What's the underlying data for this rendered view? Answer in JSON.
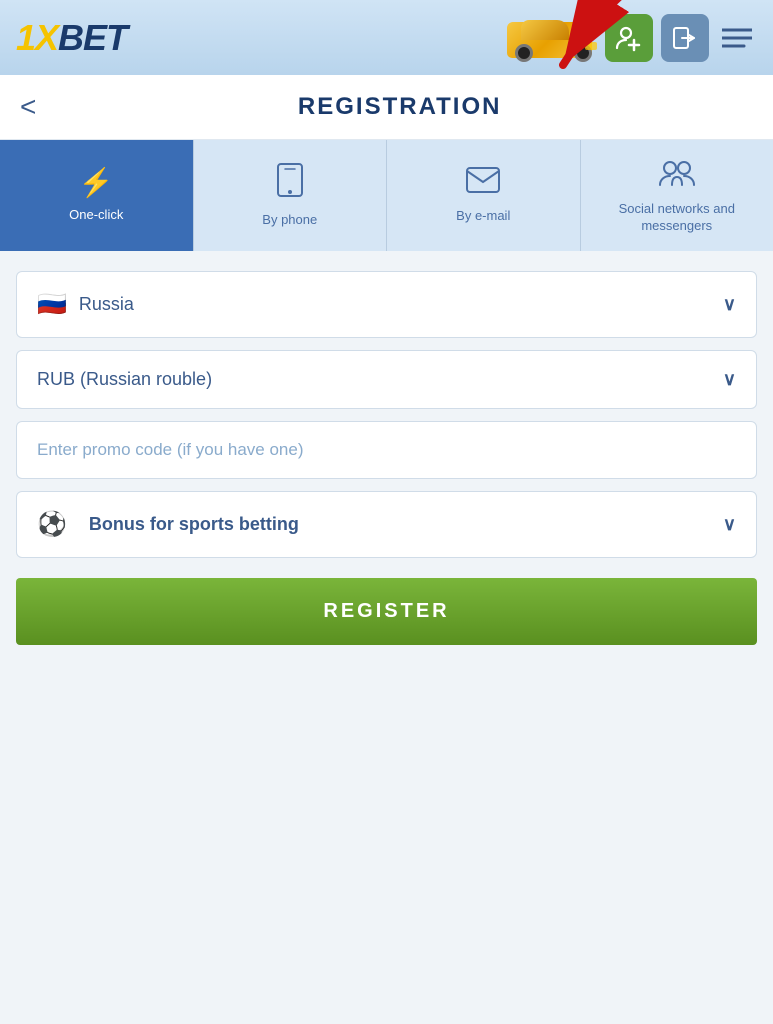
{
  "header": {
    "logo_text": "1XBET",
    "buttons": {
      "profile_label": "profile-icon",
      "login_label": "login-icon",
      "menu_label": "menu-icon"
    }
  },
  "page": {
    "back_label": "<",
    "title": "REGISTRATION"
  },
  "tabs": [
    {
      "id": "one-click",
      "icon": "⚡",
      "label": "One-click",
      "active": true
    },
    {
      "id": "by-phone",
      "icon": "📱",
      "label": "By phone",
      "active": false
    },
    {
      "id": "by-email",
      "icon": "✉",
      "label": "By e-mail",
      "active": false
    },
    {
      "id": "social",
      "icon": "👥",
      "label": "Social networks and messengers",
      "active": false
    }
  ],
  "form": {
    "country_label": "Russia",
    "currency_label": "RUB (Russian rouble)",
    "promo_placeholder": "Enter promo code (if you have one)",
    "bonus_label": "Bonus for sports betting",
    "register_button": "REGISTER"
  },
  "arrow": {
    "description": "Red arrow pointing to profile button"
  }
}
